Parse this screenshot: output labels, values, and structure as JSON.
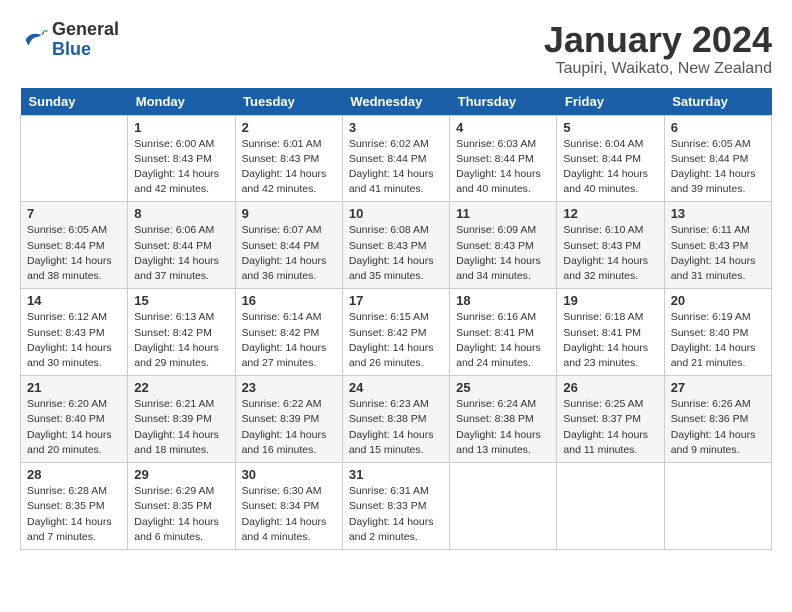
{
  "header": {
    "logo_general": "General",
    "logo_blue": "Blue",
    "month_title": "January 2024",
    "location": "Taupiri, Waikato, New Zealand"
  },
  "weekdays": [
    "Sunday",
    "Monday",
    "Tuesday",
    "Wednesday",
    "Thursday",
    "Friday",
    "Saturday"
  ],
  "weeks": [
    [
      {
        "day": "",
        "info": ""
      },
      {
        "day": "1",
        "info": "Sunrise: 6:00 AM\nSunset: 8:43 PM\nDaylight: 14 hours\nand 42 minutes."
      },
      {
        "day": "2",
        "info": "Sunrise: 6:01 AM\nSunset: 8:43 PM\nDaylight: 14 hours\nand 42 minutes."
      },
      {
        "day": "3",
        "info": "Sunrise: 6:02 AM\nSunset: 8:44 PM\nDaylight: 14 hours\nand 41 minutes."
      },
      {
        "day": "4",
        "info": "Sunrise: 6:03 AM\nSunset: 8:44 PM\nDaylight: 14 hours\nand 40 minutes."
      },
      {
        "day": "5",
        "info": "Sunrise: 6:04 AM\nSunset: 8:44 PM\nDaylight: 14 hours\nand 40 minutes."
      },
      {
        "day": "6",
        "info": "Sunrise: 6:05 AM\nSunset: 8:44 PM\nDaylight: 14 hours\nand 39 minutes."
      }
    ],
    [
      {
        "day": "7",
        "info": "Sunrise: 6:05 AM\nSunset: 8:44 PM\nDaylight: 14 hours\nand 38 minutes."
      },
      {
        "day": "8",
        "info": "Sunrise: 6:06 AM\nSunset: 8:44 PM\nDaylight: 14 hours\nand 37 minutes."
      },
      {
        "day": "9",
        "info": "Sunrise: 6:07 AM\nSunset: 8:44 PM\nDaylight: 14 hours\nand 36 minutes."
      },
      {
        "day": "10",
        "info": "Sunrise: 6:08 AM\nSunset: 8:43 PM\nDaylight: 14 hours\nand 35 minutes."
      },
      {
        "day": "11",
        "info": "Sunrise: 6:09 AM\nSunset: 8:43 PM\nDaylight: 14 hours\nand 34 minutes."
      },
      {
        "day": "12",
        "info": "Sunrise: 6:10 AM\nSunset: 8:43 PM\nDaylight: 14 hours\nand 32 minutes."
      },
      {
        "day": "13",
        "info": "Sunrise: 6:11 AM\nSunset: 8:43 PM\nDaylight: 14 hours\nand 31 minutes."
      }
    ],
    [
      {
        "day": "14",
        "info": "Sunrise: 6:12 AM\nSunset: 8:43 PM\nDaylight: 14 hours\nand 30 minutes."
      },
      {
        "day": "15",
        "info": "Sunrise: 6:13 AM\nSunset: 8:42 PM\nDaylight: 14 hours\nand 29 minutes."
      },
      {
        "day": "16",
        "info": "Sunrise: 6:14 AM\nSunset: 8:42 PM\nDaylight: 14 hours\nand 27 minutes."
      },
      {
        "day": "17",
        "info": "Sunrise: 6:15 AM\nSunset: 8:42 PM\nDaylight: 14 hours\nand 26 minutes."
      },
      {
        "day": "18",
        "info": "Sunrise: 6:16 AM\nSunset: 8:41 PM\nDaylight: 14 hours\nand 24 minutes."
      },
      {
        "day": "19",
        "info": "Sunrise: 6:18 AM\nSunset: 8:41 PM\nDaylight: 14 hours\nand 23 minutes."
      },
      {
        "day": "20",
        "info": "Sunrise: 6:19 AM\nSunset: 8:40 PM\nDaylight: 14 hours\nand 21 minutes."
      }
    ],
    [
      {
        "day": "21",
        "info": "Sunrise: 6:20 AM\nSunset: 8:40 PM\nDaylight: 14 hours\nand 20 minutes."
      },
      {
        "day": "22",
        "info": "Sunrise: 6:21 AM\nSunset: 8:39 PM\nDaylight: 14 hours\nand 18 minutes."
      },
      {
        "day": "23",
        "info": "Sunrise: 6:22 AM\nSunset: 8:39 PM\nDaylight: 14 hours\nand 16 minutes."
      },
      {
        "day": "24",
        "info": "Sunrise: 6:23 AM\nSunset: 8:38 PM\nDaylight: 14 hours\nand 15 minutes."
      },
      {
        "day": "25",
        "info": "Sunrise: 6:24 AM\nSunset: 8:38 PM\nDaylight: 14 hours\nand 13 minutes."
      },
      {
        "day": "26",
        "info": "Sunrise: 6:25 AM\nSunset: 8:37 PM\nDaylight: 14 hours\nand 11 minutes."
      },
      {
        "day": "27",
        "info": "Sunrise: 6:26 AM\nSunset: 8:36 PM\nDaylight: 14 hours\nand 9 minutes."
      }
    ],
    [
      {
        "day": "28",
        "info": "Sunrise: 6:28 AM\nSunset: 8:35 PM\nDaylight: 14 hours\nand 7 minutes."
      },
      {
        "day": "29",
        "info": "Sunrise: 6:29 AM\nSunset: 8:35 PM\nDaylight: 14 hours\nand 6 minutes."
      },
      {
        "day": "30",
        "info": "Sunrise: 6:30 AM\nSunset: 8:34 PM\nDaylight: 14 hours\nand 4 minutes."
      },
      {
        "day": "31",
        "info": "Sunrise: 6:31 AM\nSunset: 8:33 PM\nDaylight: 14 hours\nand 2 minutes."
      },
      {
        "day": "",
        "info": ""
      },
      {
        "day": "",
        "info": ""
      },
      {
        "day": "",
        "info": ""
      }
    ]
  ]
}
